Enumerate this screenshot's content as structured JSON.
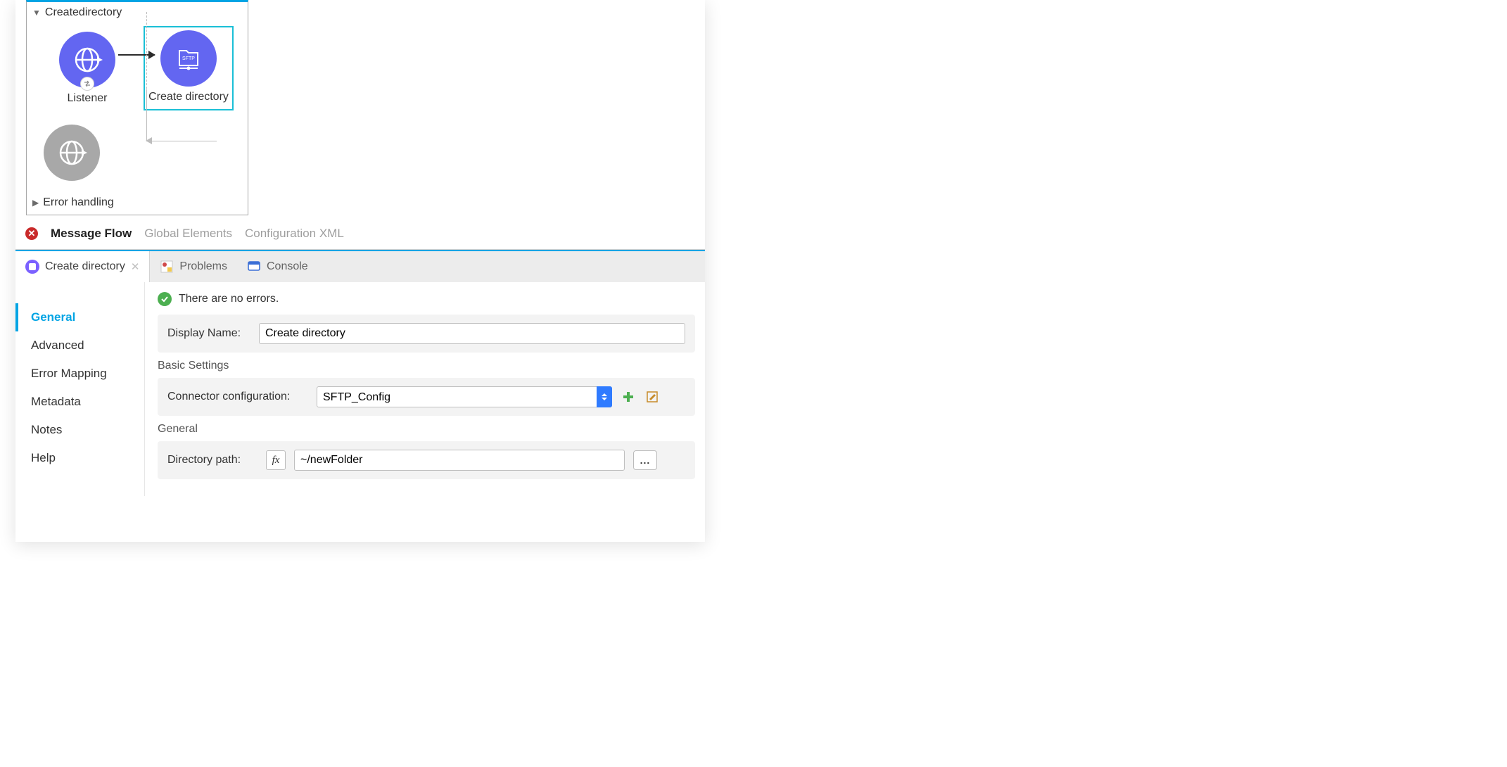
{
  "flow": {
    "title": "Createdirectory",
    "node1_label": "Listener",
    "node2_label": "Create directory",
    "sftp_badge": "SFTP",
    "error_handling": "Error handling"
  },
  "editorTabs": {
    "active": "Message Flow",
    "globals": "Global Elements",
    "config": "Configuration XML"
  },
  "bottomTabs": {
    "create_dir": "Create directory",
    "problems": "Problems",
    "console": "Console"
  },
  "sidebar": {
    "general": "General",
    "advanced": "Advanced",
    "error_mapping": "Error Mapping",
    "metadata": "Metadata",
    "notes": "Notes",
    "help": "Help"
  },
  "form": {
    "status": "There are no errors.",
    "display_name_label": "Display Name:",
    "display_name_value": "Create directory",
    "basic_settings_title": "Basic Settings",
    "connector_config_label": "Connector configuration:",
    "connector_config_value": "SFTP_Config",
    "general_title": "General",
    "directory_path_label": "Directory path:",
    "directory_path_value": "~/newFolder",
    "fx_label": "fx",
    "dots_label": "..."
  }
}
